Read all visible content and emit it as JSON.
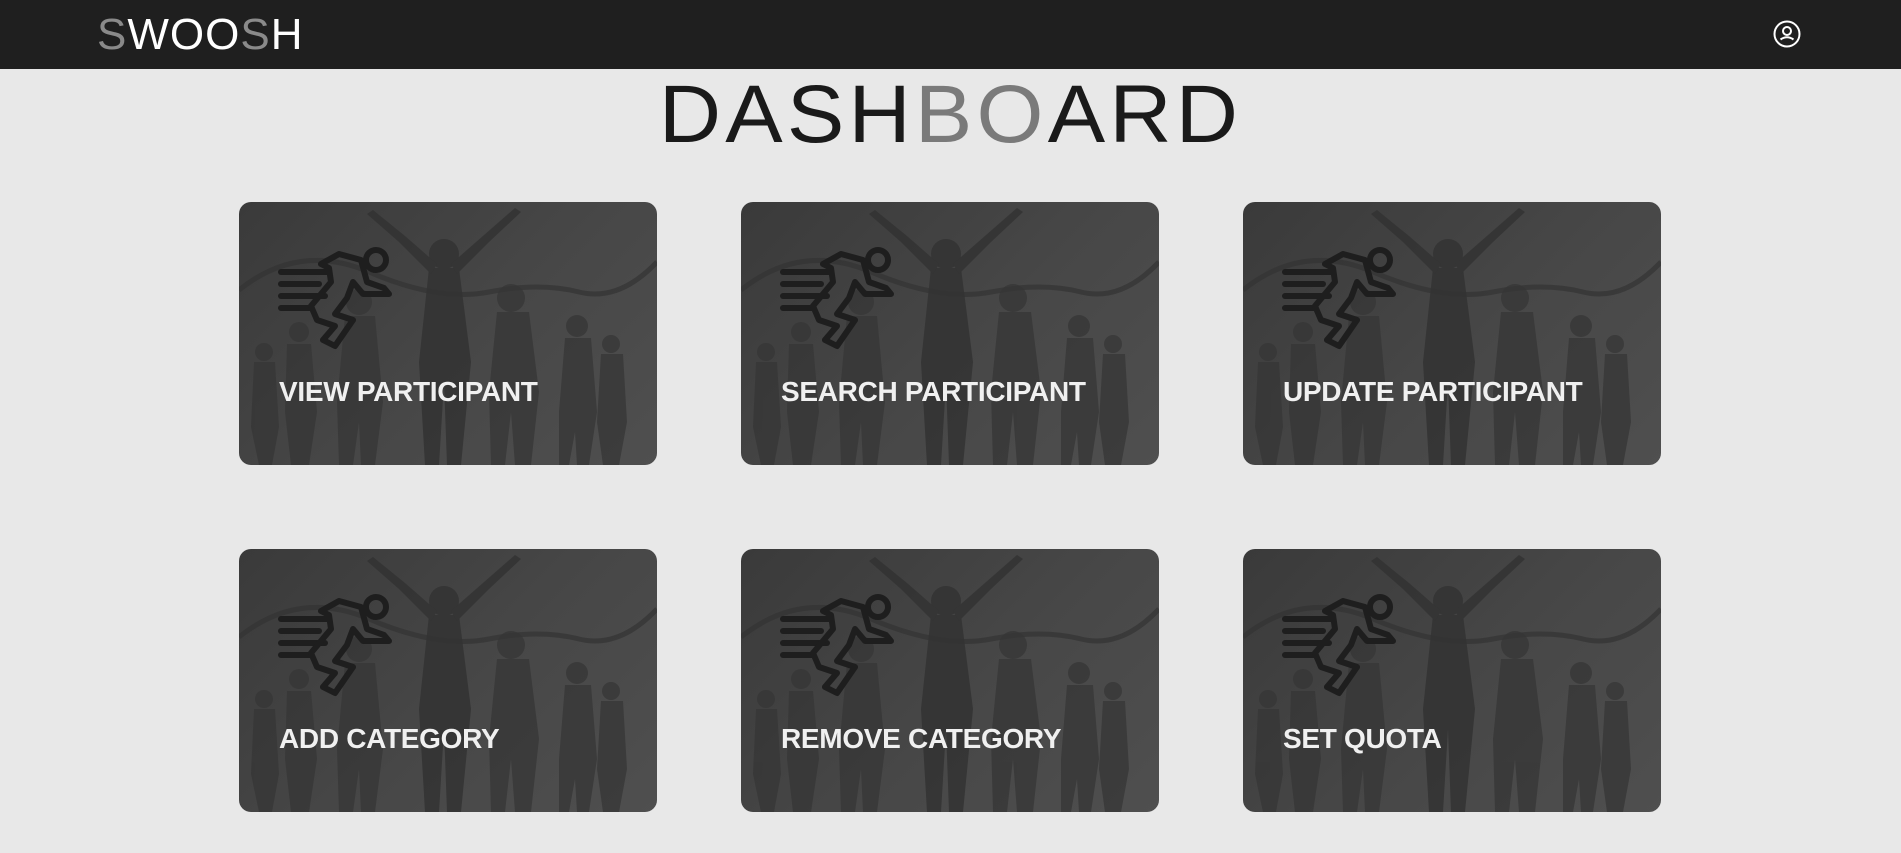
{
  "header": {
    "logo_letters": [
      {
        "ch": "S",
        "color": "#8a8a8a"
      },
      {
        "ch": "W",
        "color": "#ffffff"
      },
      {
        "ch": "O",
        "color": "#ffffff"
      },
      {
        "ch": "O",
        "color": "#ffffff"
      },
      {
        "ch": "S",
        "color": "#8a8a8a"
      },
      {
        "ch": "H",
        "color": "#ffffff"
      }
    ],
    "profile_icon": "user-circle-icon"
  },
  "title": {
    "part1": "DASH",
    "part2": "BO",
    "part3": "ARD",
    "dark_color": "#1a1a1a",
    "accent_color": "#7a7a7a"
  },
  "cards": [
    {
      "label": "VIEW PARTICIPANT",
      "icon": "runner-icon"
    },
    {
      "label": "SEARCH PARTICIPANT",
      "icon": "runner-icon"
    },
    {
      "label": "UPDATE PARTICIPANT",
      "icon": "runner-icon"
    },
    {
      "label": "ADD CATEGORY",
      "icon": "runner-icon"
    },
    {
      "label": "REMOVE CATEGORY",
      "icon": "runner-icon"
    },
    {
      "label": "SET QUOTA",
      "icon": "runner-icon"
    }
  ],
  "colors": {
    "topbar": "#1f1f1f",
    "page_background": "#e8e8e8",
    "card": "#444444"
  }
}
